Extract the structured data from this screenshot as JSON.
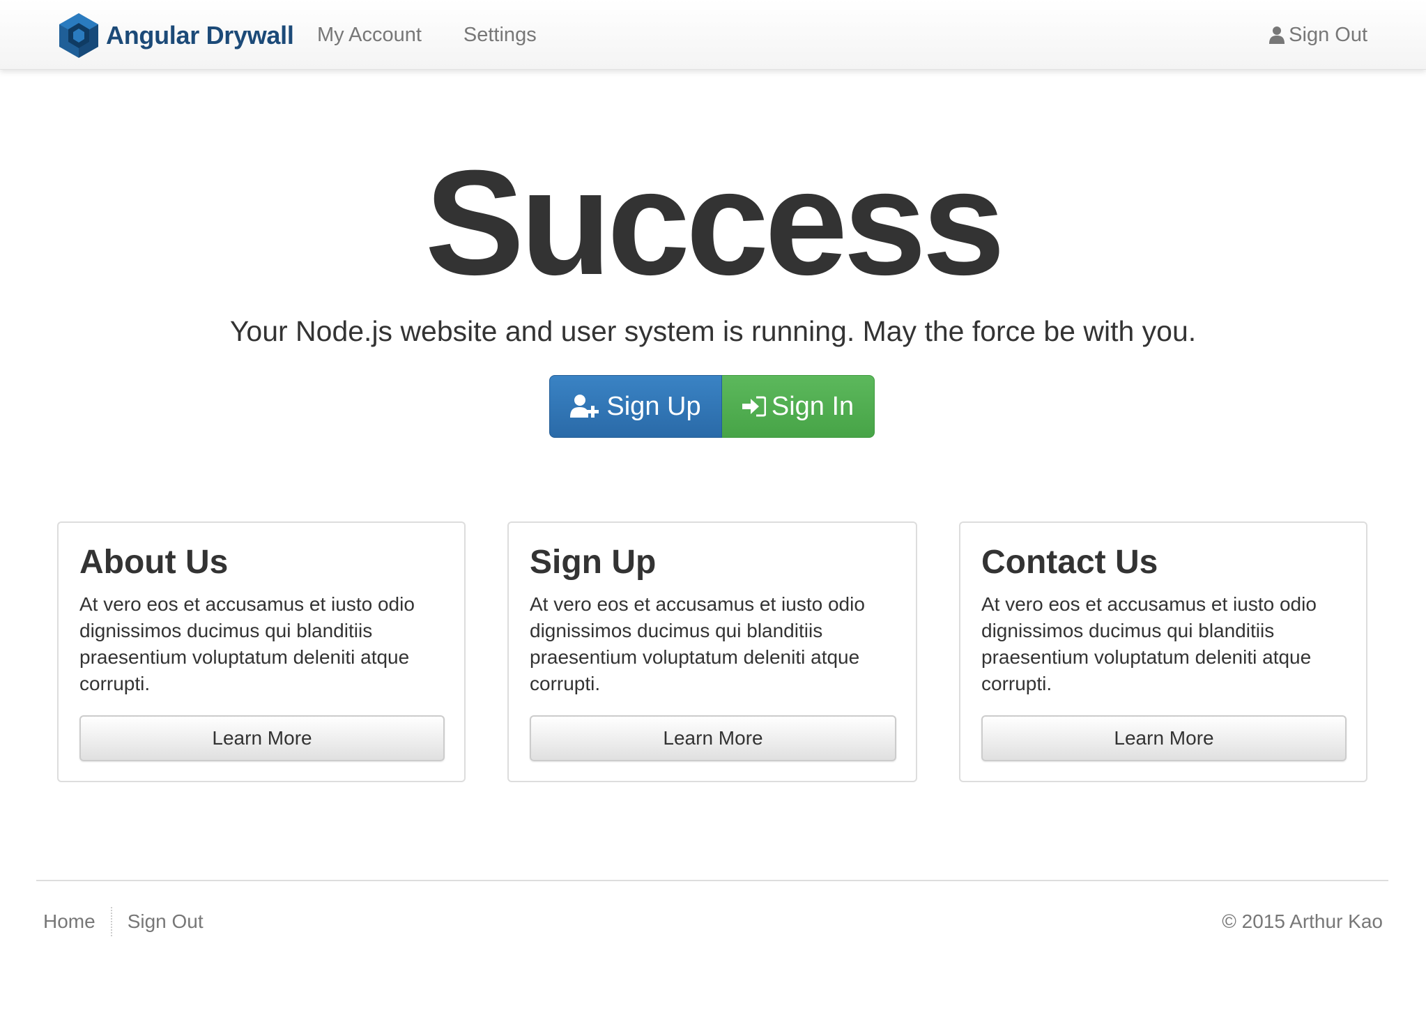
{
  "navbar": {
    "brand": "Angular Drywall",
    "links": [
      "My Account",
      "Settings"
    ],
    "signout": "Sign Out"
  },
  "hero": {
    "title": "Success",
    "lead": "Your Node.js website and user system is running. May the force be with you.",
    "signup_label": "Sign Up",
    "signin_label": "Sign In"
  },
  "cards": [
    {
      "title": "About Us",
      "text": "At vero eos et accusamus et iusto odio dignissimos ducimus qui blanditiis praesentium voluptatum deleniti atque corrupti.",
      "button": "Learn More"
    },
    {
      "title": "Sign Up",
      "text": "At vero eos et accusamus et iusto odio dignissimos ducimus qui blanditiis praesentium voluptatum deleniti atque corrupti.",
      "button": "Learn More"
    },
    {
      "title": "Contact Us",
      "text": "At vero eos et accusamus et iusto odio dignissimos ducimus qui blanditiis praesentium voluptatum deleniti atque corrupti.",
      "button": "Learn More"
    }
  ],
  "footer": {
    "links": [
      "Home",
      "Sign Out"
    ],
    "copyright": "© 2015 Arthur Kao"
  },
  "icons": {
    "brand": "hexagon-cube-logo",
    "signout": "user-icon",
    "signup": "user-plus-icon",
    "signin": "sign-in-icon"
  },
  "colors": {
    "brand": "#1c4a78",
    "primary": "#2f78b9",
    "success": "#52b152",
    "nav_text": "#777777",
    "text": "#333333"
  }
}
